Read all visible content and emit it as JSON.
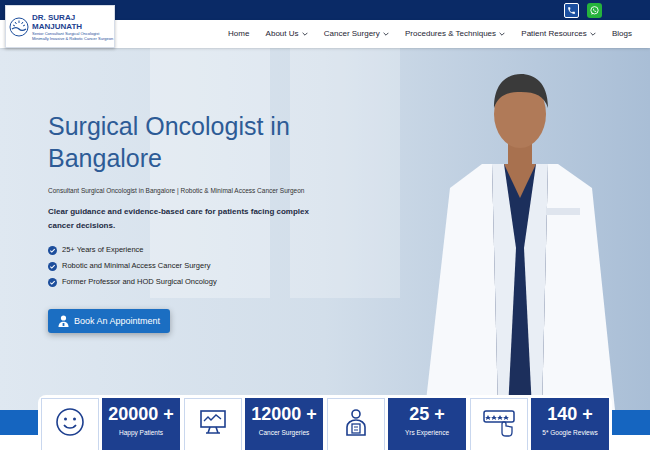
{
  "logo": {
    "name_lines": [
      "DR. SURAJ",
      "MANJUNATH"
    ],
    "tagline": [
      "Senior Consultant Surgical Oncologist",
      "Minimally Invasive & Robotic Cancer Surgeon"
    ]
  },
  "nav": {
    "items": [
      {
        "label": "Home",
        "has_dropdown": false
      },
      {
        "label": "About Us",
        "has_dropdown": true
      },
      {
        "label": "Cancer Surgery",
        "has_dropdown": true
      },
      {
        "label": "Procedures & Techniques",
        "has_dropdown": true
      },
      {
        "label": "Patient Resources",
        "has_dropdown": true
      },
      {
        "label": "Blogs",
        "has_dropdown": false
      }
    ]
  },
  "hero": {
    "title": "Surgical Oncologist in Bangalore",
    "subtitle": "Consultant Surgical Oncologist in Bangalore | Robotic & Minimal Access Cancer Surgeon",
    "lead": "Clear guidance and evidence-based care for patients facing complex cancer decisions.",
    "bullets": [
      "25+ Years of Experience",
      "Robotic and Minimal Access Cancer Surgery",
      "Former Professor and HOD Surgical Oncology"
    ],
    "button": "Book An Appointment"
  },
  "stats": [
    {
      "value": "20000 +",
      "label": "Happy Patients"
    },
    {
      "value": "12000 +",
      "label": "Cancer Surgeries"
    },
    {
      "value": "25 +",
      "label": "Yrs Experience"
    },
    {
      "value": "140 +",
      "label": "5* Google Reviews"
    }
  ]
}
